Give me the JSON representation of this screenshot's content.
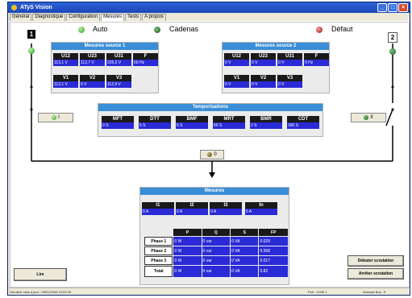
{
  "side_caption": "atys_610_a_1_x_cat",
  "window": {
    "title": "ATyS Vision",
    "min": "_",
    "max": "□",
    "close": "×"
  },
  "tabs": [
    "Général",
    "Diagnostique",
    "Configuration",
    "Mesures",
    "Tests",
    "A propos"
  ],
  "modes": {
    "auto": "Auto",
    "cadenas": "Cadenas",
    "defaut": "Défaut"
  },
  "sources": {
    "s1_label": "1",
    "s2_label": "2",
    "s1_switch": "I",
    "s2_switch": "II",
    "zero_switch": "0"
  },
  "source1": {
    "title": "Mesures source 1",
    "row1": [
      {
        "h": "U12",
        "v": "113,1 V"
      },
      {
        "h": "U23",
        "v": "112,7 V"
      },
      {
        "h": "U31",
        "v": "226,5 V"
      },
      {
        "h": "F",
        "v": "50 Hz"
      }
    ],
    "row2": [
      {
        "h": "V1",
        "v": "113,1 V"
      },
      {
        "h": "V2",
        "v": "0 V"
      },
      {
        "h": "V3",
        "v": "112,9 V"
      }
    ]
  },
  "source2": {
    "title": "Mesures source 2",
    "row1": [
      {
        "h": "U12",
        "v": "0 V"
      },
      {
        "h": "U23",
        "v": "0 V"
      },
      {
        "h": "U31",
        "v": "0 V"
      },
      {
        "h": "F",
        "v": "0 Hz"
      }
    ],
    "row2": [
      {
        "h": "V1",
        "v": "0 V"
      },
      {
        "h": "V2",
        "v": "0 V"
      },
      {
        "h": "V3",
        "v": "0 V"
      }
    ]
  },
  "temporisations": {
    "title": "Temporisations",
    "items": [
      {
        "h": "MFT",
        "v": "0 S"
      },
      {
        "h": "DTT",
        "v": "5 S"
      },
      {
        "h": "BMF",
        "v": "5 S"
      },
      {
        "h": "MRT",
        "v": "60 S"
      },
      {
        "h": "BMR",
        "v": "2 S"
      },
      {
        "h": "CDT",
        "v": "180 S"
      }
    ]
  },
  "mesures": {
    "title": "Mesures",
    "currents": [
      {
        "h": "I1",
        "v": "0 A"
      },
      {
        "h": "I2",
        "v": "0 A"
      },
      {
        "h": "I3",
        "v": "0 A"
      },
      {
        "h": "In",
        "v": "0 A"
      }
    ],
    "power_headers": [
      "P",
      "Q",
      "S",
      "FP"
    ],
    "power_rows": [
      {
        "label": "Phase 1",
        "values": [
          "0 W",
          "0 var",
          "0 VA",
          "0.029"
        ]
      },
      {
        "label": "Phase 2",
        "values": [
          "0 W",
          "0 var",
          "0 VA",
          "0.998"
        ]
      },
      {
        "label": "Phase 3",
        "values": [
          "0 W",
          "0 var",
          "0 VA",
          "0.017"
        ]
      },
      {
        "label": "Total",
        "values": [
          "0 W",
          "0 var",
          "0 VA",
          "0.82"
        ]
      }
    ]
  },
  "buttons": {
    "lire": "Lire",
    "debuter": "Débuter scrutation",
    "arreter": "Arrêter scrutation"
  },
  "status": {
    "left": "Dernière mise à jour : 09/01/2006 10:53:25",
    "port": "Port : COM 1",
    "adresse": "Adresse Bus : 5"
  }
}
